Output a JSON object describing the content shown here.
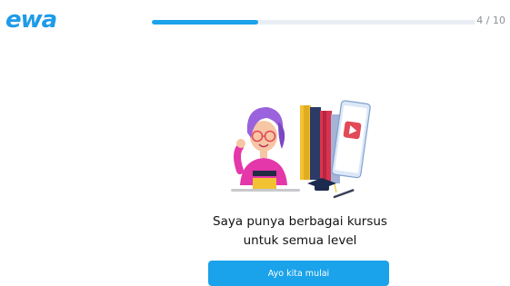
{
  "header": {
    "logo_text": "ewa",
    "progress": {
      "current": 4,
      "total": 10,
      "fraction": 0.33,
      "label": "4 / 10"
    }
  },
  "main": {
    "illustration_icon": "teacher-with-books-illustration",
    "headline": [
      "Saya punya berbagai kursus",
      "untuk semua level"
    ],
    "cta_label": "Ayo kita mulai"
  },
  "colors": {
    "accent": "#1aa2ea",
    "track": "#e8eef3",
    "text": "#111111",
    "muted": "#8b8f94"
  }
}
